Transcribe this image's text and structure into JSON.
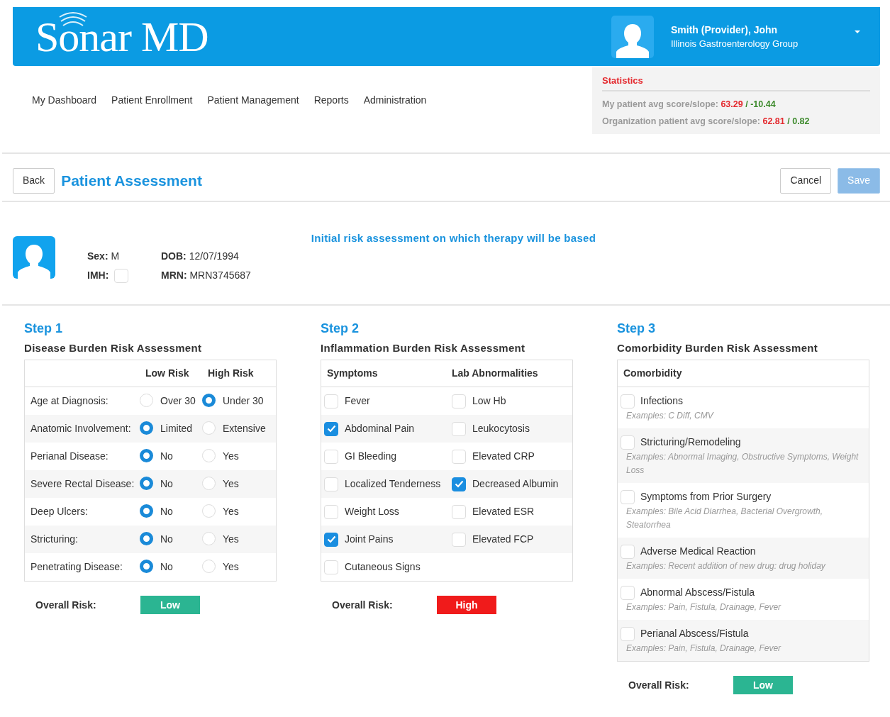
{
  "brand": "Sonar MD",
  "user": {
    "name": "Smith (Provider), John",
    "organization": "Illinois Gastroenterology Group"
  },
  "nav": [
    "My Dashboard",
    "Patient Enrollment",
    "Patient Management",
    "Reports",
    "Administration"
  ],
  "statistics": {
    "title": "Statistics",
    "rows": [
      {
        "label": "My patient avg score/slope:",
        "score": "63.29",
        "separator": "/",
        "slope": "-10.44"
      },
      {
        "label": "Organization patient avg score/slope:",
        "score": "62.81",
        "separator": "/",
        "slope": "0.82"
      }
    ]
  },
  "toolbar": {
    "back": "Back",
    "title": "Patient Assessment",
    "cancel": "Cancel",
    "save": {
      "label": "Save",
      "disabled": true
    }
  },
  "patient": {
    "note": "Initial risk assessment on which therapy will be based",
    "sex_label": "Sex:",
    "sex": "M",
    "imh_label": "IMH:",
    "imh_checked": false,
    "dob_label": "DOB:",
    "dob": "12/07/1994",
    "mrn_label": "MRN:",
    "mrn": "MRN3745687"
  },
  "steps": [
    {
      "kind": "radio-table",
      "step": "Step 1",
      "title": "Disease Burden Risk Assessment",
      "columns": [
        "Low Risk",
        "High Risk"
      ],
      "rows": [
        {
          "label": "Age at Diagnosis:",
          "options": [
            {
              "label": "Over 30",
              "selected": false
            },
            {
              "label": "Under 30",
              "selected": true
            }
          ]
        },
        {
          "label": "Anatomic Involvement:",
          "options": [
            {
              "label": "Limited",
              "selected": true
            },
            {
              "label": "Extensive",
              "selected": false
            }
          ]
        },
        {
          "label": "Perianal Disease:",
          "options": [
            {
              "label": "No",
              "selected": true
            },
            {
              "label": "Yes",
              "selected": false
            }
          ]
        },
        {
          "label": "Severe Rectal Disease:",
          "options": [
            {
              "label": "No",
              "selected": true
            },
            {
              "label": "Yes",
              "selected": false
            }
          ]
        },
        {
          "label": "Deep Ulcers:",
          "options": [
            {
              "label": "No",
              "selected": true
            },
            {
              "label": "Yes",
              "selected": false
            }
          ]
        },
        {
          "label": "Stricturing:",
          "options": [
            {
              "label": "No",
              "selected": true
            },
            {
              "label": "Yes",
              "selected": false
            }
          ]
        },
        {
          "label": "Penetrating Disease:",
          "options": [
            {
              "label": "No",
              "selected": true
            },
            {
              "label": "Yes",
              "selected": false
            }
          ]
        }
      ],
      "overall_label": "Overall Risk:",
      "overall": {
        "label": "Low",
        "color": "#2bb592"
      }
    },
    {
      "kind": "checklist-table",
      "step": "Step 2",
      "title": "Inflammation Burden Risk Assessment",
      "columns": [
        "Symptoms",
        "Lab Abnormalities"
      ],
      "rows": [
        {
          "cells": [
            {
              "label": "Fever",
              "checked": false
            },
            {
              "label": "Low Hb",
              "checked": false
            }
          ]
        },
        {
          "cells": [
            {
              "label": "Abdominal Pain",
              "checked": true
            },
            {
              "label": "Leukocytosis",
              "checked": false
            }
          ]
        },
        {
          "cells": [
            {
              "label": "GI Bleeding",
              "checked": false
            },
            {
              "label": "Elevated CRP",
              "checked": false
            }
          ]
        },
        {
          "cells": [
            {
              "label": "Localized Tenderness",
              "checked": false
            },
            {
              "label": "Decreased Albumin",
              "checked": true
            }
          ]
        },
        {
          "cells": [
            {
              "label": "Weight Loss",
              "checked": false
            },
            {
              "label": "Elevated ESR",
              "checked": false
            }
          ]
        },
        {
          "cells": [
            {
              "label": "Joint Pains",
              "checked": true
            },
            {
              "label": "Elevated FCP",
              "checked": false
            }
          ]
        },
        {
          "cells": [
            {
              "label": "Cutaneous Signs",
              "checked": false
            }
          ]
        }
      ],
      "overall_label": "Overall Risk:",
      "overall": {
        "label": "High",
        "color": "#f01b1b"
      }
    },
    {
      "kind": "comorbidity-list",
      "step": "Step 3",
      "title": "Comorbidity Burden Risk Assessment",
      "columns": [
        "Comorbidity"
      ],
      "rows": [
        {
          "label": "Infections",
          "examples": "Examples: C Diff, CMV",
          "checked": false
        },
        {
          "label": "Stricturing/Remodeling",
          "examples": "Examples: Abnormal Imaging, Obstructive Symptoms, Weight Loss",
          "checked": false
        },
        {
          "label": "Symptoms from Prior Surgery",
          "examples": "Examples: Bile Acid Diarrhea, Bacterial Overgrowth, Steatorrhea",
          "checked": false
        },
        {
          "label": "Adverse Medical Reaction",
          "examples": "Examples: Recent addition of new drug: drug holiday",
          "checked": false
        },
        {
          "label": "Abnormal Abscess/Fistula",
          "examples": "Examples: Pain, Fistula, Drainage, Fever",
          "checked": false
        },
        {
          "label": "Perianal Abscess/Fistula",
          "examples": "Examples: Pain, Fistula, Drainage, Fever",
          "checked": false
        }
      ],
      "overall_label": "Overall Risk:",
      "overall": {
        "label": "Low",
        "color": "#2bb592"
      }
    }
  ]
}
